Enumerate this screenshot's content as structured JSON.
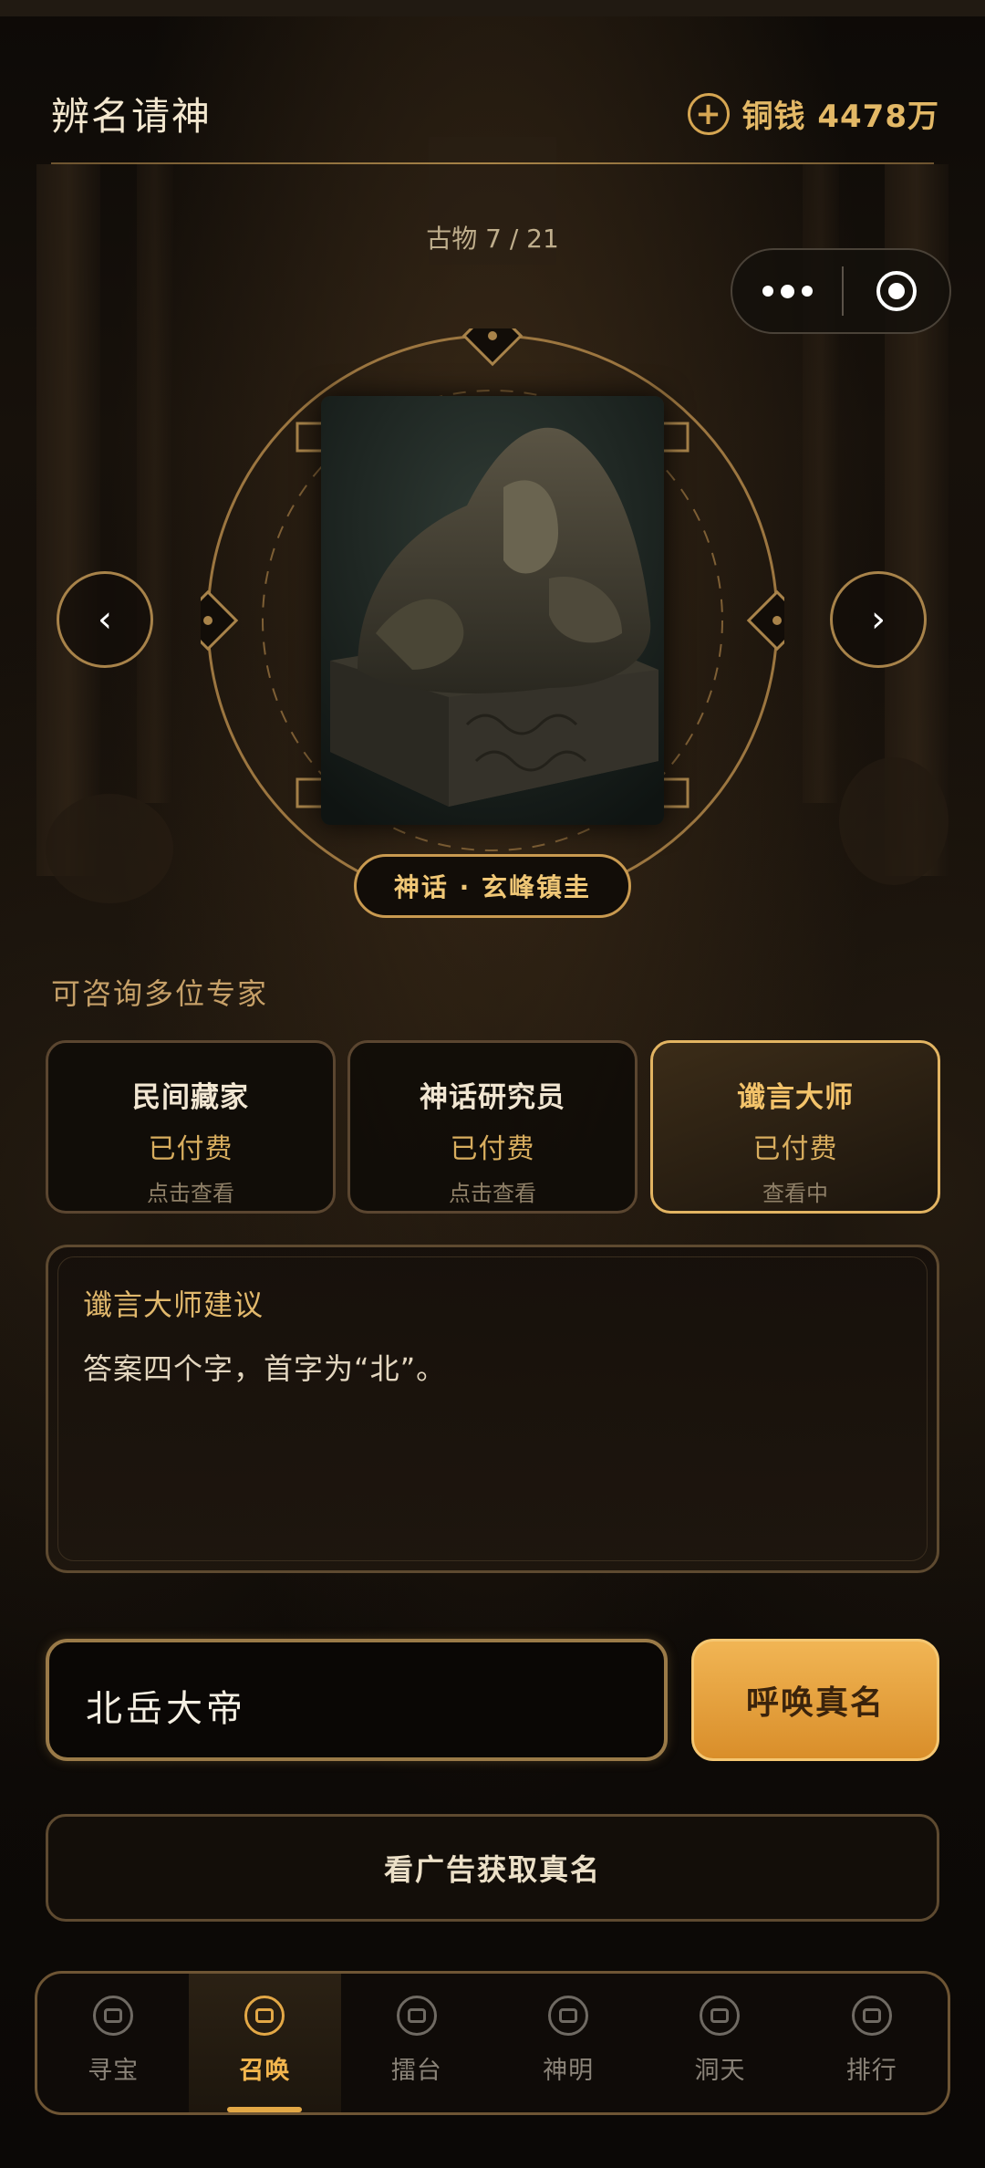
{
  "header": {
    "title": "辨名请神",
    "coins_label": "铜钱 4478万"
  },
  "progress": "古物 7 / 21",
  "artifact": {
    "name": "神话 · 玄峰镇圭"
  },
  "experts": {
    "section_label": "可咨询多位专家",
    "items": [
      {
        "name": "民间藏家",
        "status": "已付费",
        "hint": "点击查看"
      },
      {
        "name": "神话研究员",
        "status": "已付费",
        "hint": "点击查看"
      },
      {
        "name": "谶言大师",
        "status": "已付费",
        "hint": "查看中"
      }
    ]
  },
  "advice": {
    "title": "谶言大师建议",
    "text": "答案四个字，首字为“北”。"
  },
  "answer": {
    "value": "北岳大帝",
    "submit_label": "呼唤真名"
  },
  "ad_button_label": "看广告获取真名",
  "tabbar": {
    "items": [
      {
        "label": "寻宝"
      },
      {
        "label": "召唤"
      },
      {
        "label": "擂台"
      },
      {
        "label": "神明"
      },
      {
        "label": "洞天"
      },
      {
        "label": "排行"
      }
    ]
  },
  "colors": {
    "accent": "#e3a846",
    "gold_text": "#f0c776",
    "background": "#0c0906"
  }
}
